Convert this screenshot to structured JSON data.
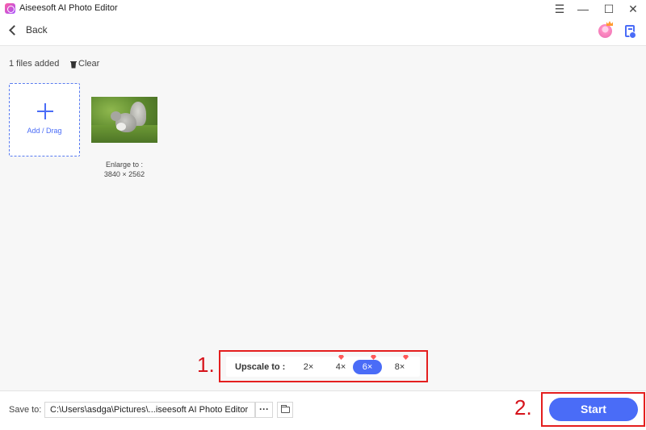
{
  "window": {
    "title": "Aiseesoft AI Photo Editor",
    "menu_glyph": "☰",
    "minimize_glyph": "—",
    "maximize_glyph": "☐",
    "close_glyph": "✕"
  },
  "header": {
    "back_label": "Back"
  },
  "files": {
    "count_label": "1 files added",
    "clear_label": "Clear",
    "add_label": "Add / Drag",
    "items": [
      {
        "enlarge_label": "Enlarge to :",
        "dimensions": "3840 × 2562"
      }
    ]
  },
  "upscale": {
    "label": "Upscale to :",
    "options": [
      {
        "label": "2×",
        "selected": false,
        "premium": false
      },
      {
        "label": "4×",
        "selected": false,
        "premium": true
      },
      {
        "label": "6×",
        "selected": true,
        "premium": true
      },
      {
        "label": "8×",
        "selected": false,
        "premium": true
      }
    ],
    "accent_color": "#4a6cf7"
  },
  "annotations": {
    "step1": "1.",
    "step2": "2.",
    "highlight_color": "#e41e1e"
  },
  "bottom": {
    "save_label": "Save to:",
    "path": "C:\\Users\\asdga\\Pictures\\...iseesoft AI Photo Editor",
    "more_label": "···",
    "start_label": "Start"
  },
  "icons": {
    "app": "app-logo-icon",
    "back": "chevron-left-icon",
    "avatar": "user-avatar-icon",
    "task": "task-list-icon",
    "clear": "trash-icon",
    "add": "plus-icon",
    "folder": "folder-icon"
  }
}
